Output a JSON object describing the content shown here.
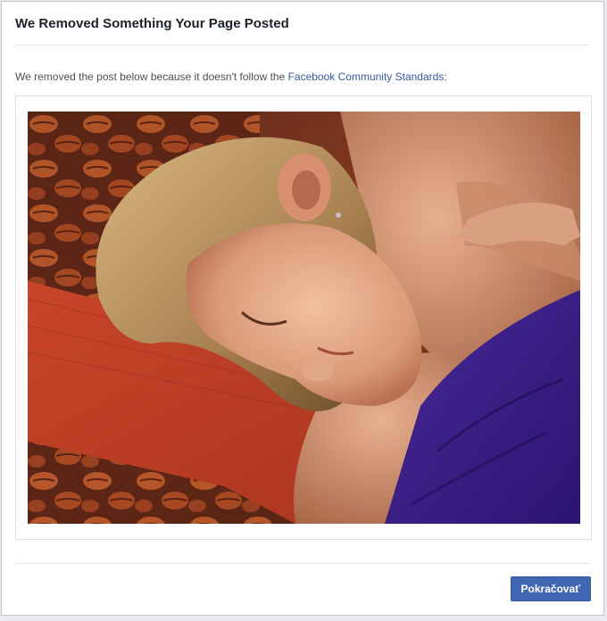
{
  "dialog": {
    "title": "We Removed Something Your Page Posted",
    "message_prefix": "We removed the post below because it doesn't follow the ",
    "standards_link": "Facebook Community Standards",
    "message_suffix": ":",
    "continue_label": "Pokračovať"
  },
  "colors": {
    "link": "#365899",
    "button": "#4267b2",
    "title_text": "#1d2129",
    "body_text": "#4b4f56"
  },
  "post": {
    "image_content": "photo-of-sleeping-child"
  }
}
